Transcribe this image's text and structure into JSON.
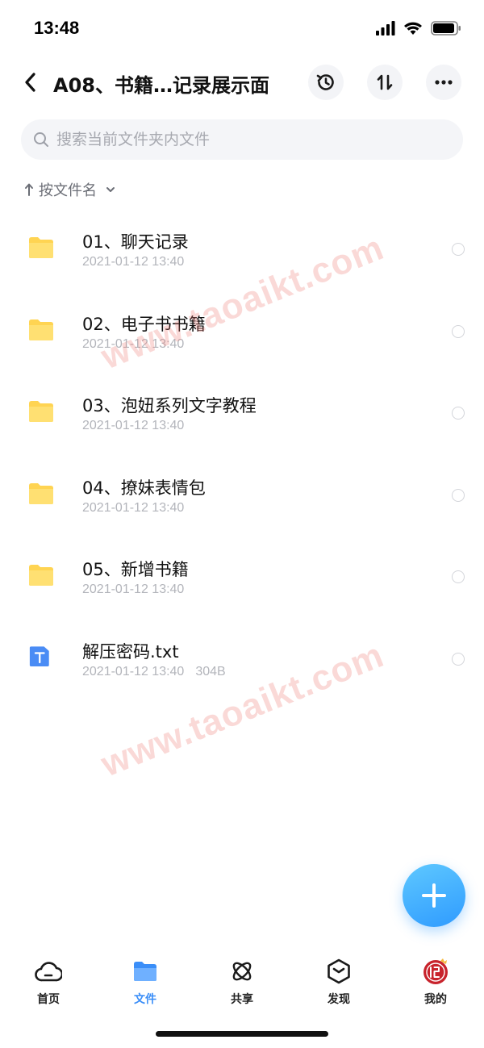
{
  "status_bar": {
    "time": "13:48"
  },
  "header": {
    "title": "A08、书籍…记录展示面",
    "history_icon": "history-icon",
    "sort_icon": "sort-toggle-icon",
    "more_icon": "more-icon"
  },
  "search": {
    "placeholder": "搜索当前文件夹内文件",
    "value": ""
  },
  "sort": {
    "label": "按文件名"
  },
  "files": [
    {
      "name": "01、聊天记录",
      "date": "2021-01-12 13:40",
      "size": "",
      "type": "folder"
    },
    {
      "name": "02、电子书书籍",
      "date": "2021-01-12 13:40",
      "size": "",
      "type": "folder"
    },
    {
      "name": "03、泡妞系列文字教程",
      "date": "2021-01-12 13:40",
      "size": "",
      "type": "folder"
    },
    {
      "name": "04、撩妹表情包",
      "date": "2021-01-12 13:40",
      "size": "",
      "type": "folder"
    },
    {
      "name": "05、新增书籍",
      "date": "2021-01-12 13:40",
      "size": "",
      "type": "folder"
    },
    {
      "name": "解压密码.txt",
      "date": "2021-01-12 13:40",
      "size": "304B",
      "type": "txt"
    }
  ],
  "watermarks": [
    "www.taoaikt.com",
    "www.taoaikt.com"
  ],
  "tabs": [
    {
      "label": "首页",
      "icon": "cloud-icon",
      "active": false
    },
    {
      "label": "文件",
      "icon": "folder-icon",
      "active": true
    },
    {
      "label": "共享",
      "icon": "atom-icon",
      "active": false
    },
    {
      "label": "发现",
      "icon": "hexagon-icon",
      "active": false
    },
    {
      "label": "我的",
      "icon": "avatar-icon",
      "active": false
    }
  ],
  "colors": {
    "accent": "#3a8ef8",
    "folder": "#ffd452",
    "txt_icon": "#4a8cf5",
    "fab": "#2f9bff",
    "watermark": "#ec786e"
  }
}
